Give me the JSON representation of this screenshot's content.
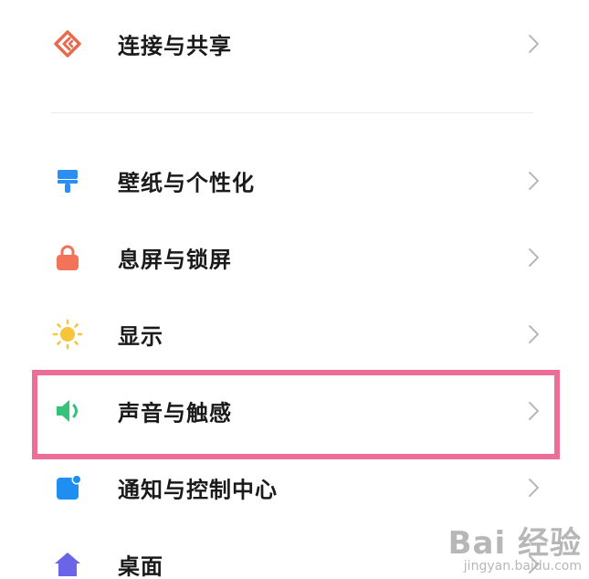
{
  "settings": {
    "items": [
      {
        "label": "连接与共享",
        "icon": "connection-share-icon",
        "color": "#e86a4c"
      },
      {
        "label": "壁纸与个性化",
        "icon": "paintbrush-icon",
        "color": "#2a8ef3"
      },
      {
        "label": "息屏与锁屏",
        "icon": "lock-icon",
        "color": "#f27358"
      },
      {
        "label": "显示",
        "icon": "sun-icon",
        "color": "#f7c43a"
      },
      {
        "label": "声音与触感",
        "icon": "speaker-icon",
        "color": "#35c27a"
      },
      {
        "label": "通知与控制中心",
        "icon": "notification-icon",
        "color": "#1e8ef0"
      },
      {
        "label": "桌面",
        "icon": "home-icon",
        "color": "#6a65e8"
      }
    ],
    "highlighted_item": "声音与触感"
  },
  "watermark": {
    "main": "Bai 经验",
    "sub": "jingyan.baidu.com"
  },
  "colors": {
    "highlight_border": "#ec6d96",
    "chevron": "#b8b8b8",
    "divider": "#ececec",
    "text": "#1a1a1a"
  }
}
